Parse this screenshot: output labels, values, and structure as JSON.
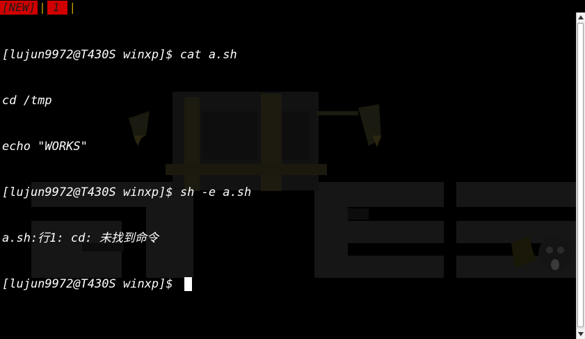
{
  "tabs": {
    "new_label": "[NEW]",
    "separator": "|",
    "active_label": "1",
    "trailing_separator": "|"
  },
  "terminal": {
    "lines": [
      {
        "prompt": "[lujun9972@T430S winxp]$ ",
        "text": "cat a.sh"
      },
      {
        "prompt": "",
        "text": "cd /tmp"
      },
      {
        "prompt": "",
        "text": "echo \"WORKS\""
      },
      {
        "prompt": "[lujun9972@T430S winxp]$ ",
        "text": "sh -e a.sh"
      },
      {
        "prompt": "",
        "text": "a.sh:行1: cd: 未找到命令"
      },
      {
        "prompt": "[lujun9972@T430S winxp]$ ",
        "text": ""
      }
    ]
  },
  "colors": {
    "background": "#000000",
    "foreground": "#ffffff",
    "tab_background": "#d10000",
    "tab_separator": "#c8a800"
  },
  "icons": {
    "scroll_up": "triangle-up-icon",
    "scroll_down": "triangle-down-icon"
  }
}
